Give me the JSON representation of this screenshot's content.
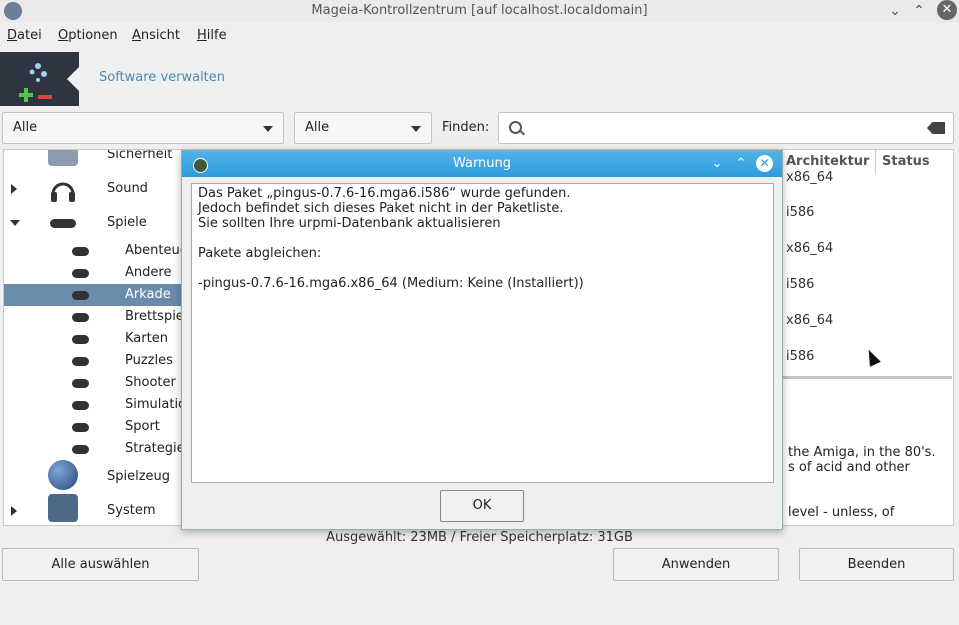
{
  "window": {
    "title": "Mageia-Kontrollzentrum [auf localhost.localdomain]"
  },
  "menu": [
    "Datei",
    "Optionen",
    "Ansicht",
    "Hilfe"
  ],
  "header": {
    "title": "Software verwalten"
  },
  "filters": {
    "left": "Alle",
    "right": "Alle",
    "find_label": "Finden:"
  },
  "tree": {
    "items": [
      {
        "label": "Sicherheit"
      },
      {
        "label": "Sound"
      },
      {
        "label": "Spiele"
      },
      {
        "label": "Abenteuer"
      },
      {
        "label": "Andere"
      },
      {
        "label": "Arkade"
      },
      {
        "label": "Brettspiele"
      },
      {
        "label": "Karten"
      },
      {
        "label": "Puzzles"
      },
      {
        "label": "Shooter"
      },
      {
        "label": "Simulation"
      },
      {
        "label": "Sport"
      },
      {
        "label": "Strategie"
      },
      {
        "label": "Spielzeug"
      },
      {
        "label": "System"
      }
    ]
  },
  "columns": {
    "arch": "Architektur",
    "status": "Status"
  },
  "arch_values": [
    "x86_64",
    "i586",
    "x86_64",
    "i586",
    "x86_64",
    "i586"
  ],
  "description": [
    "the Amiga, in the 80's.",
    "s of acid and other",
    "level - unless, of"
  ],
  "status_line": "Ausgewählt: 23MB / Freier Speicherplatz: 31GB",
  "buttons": {
    "select_all": "Alle auswählen",
    "apply": "Anwenden",
    "quit": "Beenden"
  },
  "dialog": {
    "title": "Warnung",
    "lines": [
      "Das Paket „pingus-0.7.6-16.mga6.i586“ wurde gefunden.",
      "Jedoch befindet sich dieses Paket nicht in der Paketliste.",
      "Sie sollten Ihre urpmi-Datenbank aktualisieren",
      "",
      "Pakete abgleichen:",
      "",
      "-pingus-0.7.6-16.mga6.x86_64 (Medium: Keine (Installiert))"
    ],
    "ok": "OK"
  }
}
